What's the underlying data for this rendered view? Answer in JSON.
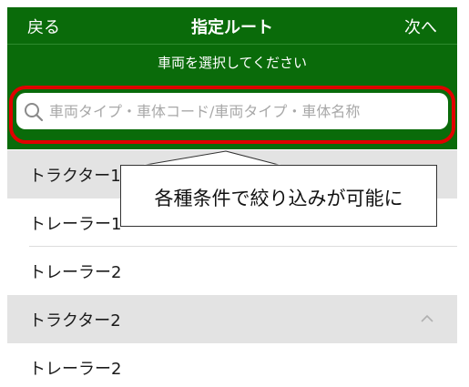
{
  "navbar": {
    "back_label": "戻る",
    "title": "指定ルート",
    "next_label": "次へ"
  },
  "subheader": {
    "text": "車両を選択してください"
  },
  "search": {
    "placeholder": "車両タイプ・車体コード/車両タイプ・車体名称",
    "icon": "search-icon"
  },
  "list": {
    "rows": [
      {
        "type": "group",
        "label": "トラクター1"
      },
      {
        "type": "item",
        "label": "トレーラー1"
      },
      {
        "type": "item",
        "label": "トレーラー2"
      },
      {
        "type": "group",
        "label": "トラクター2",
        "icon": "chevron-up-icon"
      },
      {
        "type": "item",
        "label": "トレーラー2"
      }
    ]
  },
  "callout": {
    "text": "各種条件で絞り込みが可能に"
  },
  "colors": {
    "brand_green": "#0a6b0a",
    "highlight_red": "#e00000",
    "group_row_bg": "#e3e3e3"
  }
}
